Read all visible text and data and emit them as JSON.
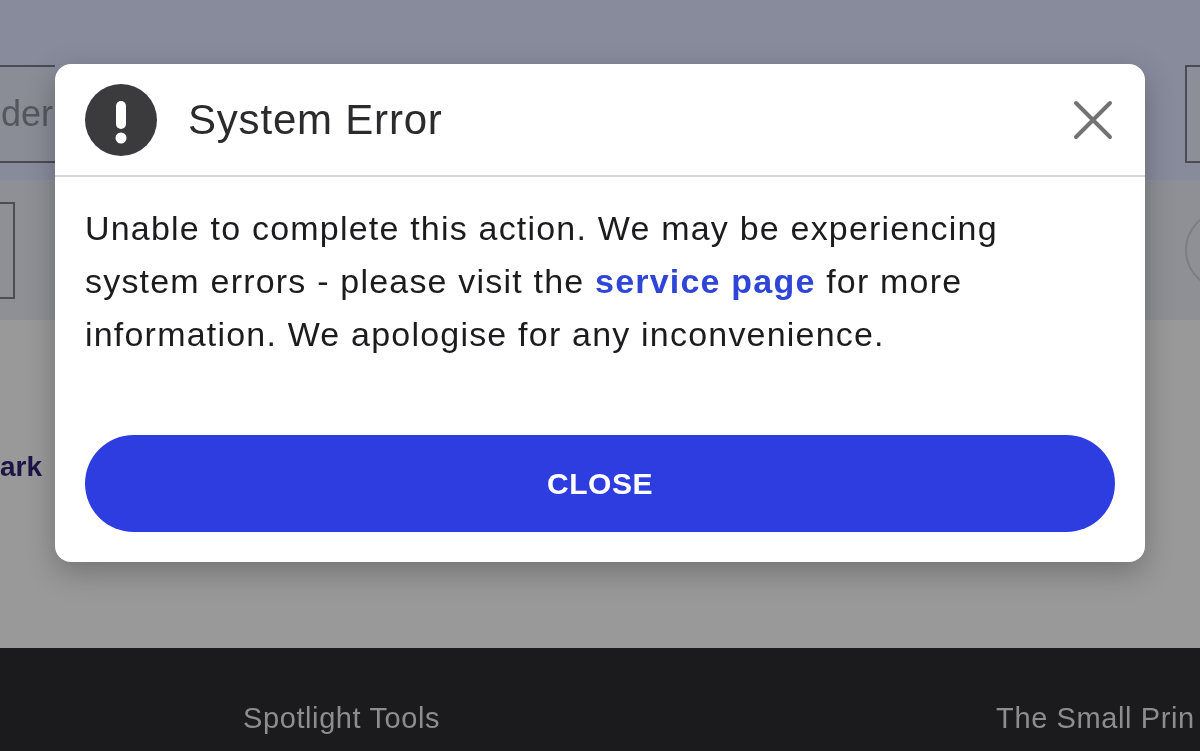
{
  "background": {
    "search_field": {
      "value": "der"
    },
    "side_link": "ark"
  },
  "dialog": {
    "title": "System Error",
    "message": {
      "before": "Unable to complete this action. We may be experiencing system errors - please visit the ",
      "link": "service page",
      "after": " for more information. We apologise for any inconvenience."
    },
    "buttons": [
      "CLOSE"
    ]
  },
  "footer": {
    "links": [
      "Spotlight Tools",
      "The Small Prin"
    ]
  }
}
